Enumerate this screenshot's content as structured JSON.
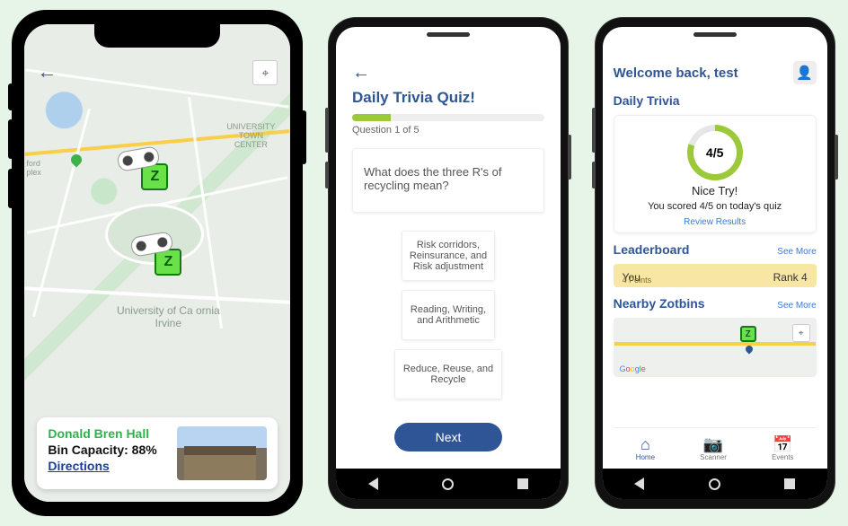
{
  "phone1": {
    "back_arrow": "←",
    "locate_glyph": "⌖",
    "zbin_letter": "Z",
    "labels": {
      "university_town_center": "UNIVERSITY\nTOWN\nCENTER",
      "uci": "University of Ca    ornia\nIrvine",
      "ford_plex": "ford\nplex"
    },
    "card": {
      "title": "Donald Bren Hall",
      "capacity_label": "Bin Capacity: 88%",
      "directions": "Directions"
    }
  },
  "phone2": {
    "back_arrow": "←",
    "title": "Daily Trivia Quiz!",
    "progress_percent": 20,
    "question_count": "Question 1 of 5",
    "question": "What does the three R's of recycling mean?",
    "options": [
      "Risk corridors, Reinsurance, and Risk adjustment",
      "Reading, Writing, and Arithmetic",
      "Reduce, Reuse, and Recycle"
    ],
    "next_label": "Next"
  },
  "phone3": {
    "welcome": "Welcome back, test",
    "avatar_glyph": "👤",
    "sections": {
      "trivia": "Daily Trivia",
      "leaderboard": "Leaderboard",
      "nearby": "Nearby Zotbins",
      "see_more": "See More"
    },
    "trivia": {
      "score_text": "4/5",
      "nice": "Nice Try!",
      "scored": "You scored 4/5 on today's quiz",
      "review": "Review Results"
    },
    "leaderboard": {
      "you": "You",
      "rank": "Rank 4",
      "points": "4 Points"
    },
    "minimap": {
      "z": "Z",
      "locate": "⌖",
      "google": [
        "G",
        "o",
        "o",
        "g",
        "l",
        "e"
      ]
    },
    "tabs": {
      "home": "Home",
      "scanner": "Scanner",
      "events": "Events",
      "home_icon": "⌂",
      "scanner_icon": "📷",
      "events_icon": "📅"
    }
  }
}
